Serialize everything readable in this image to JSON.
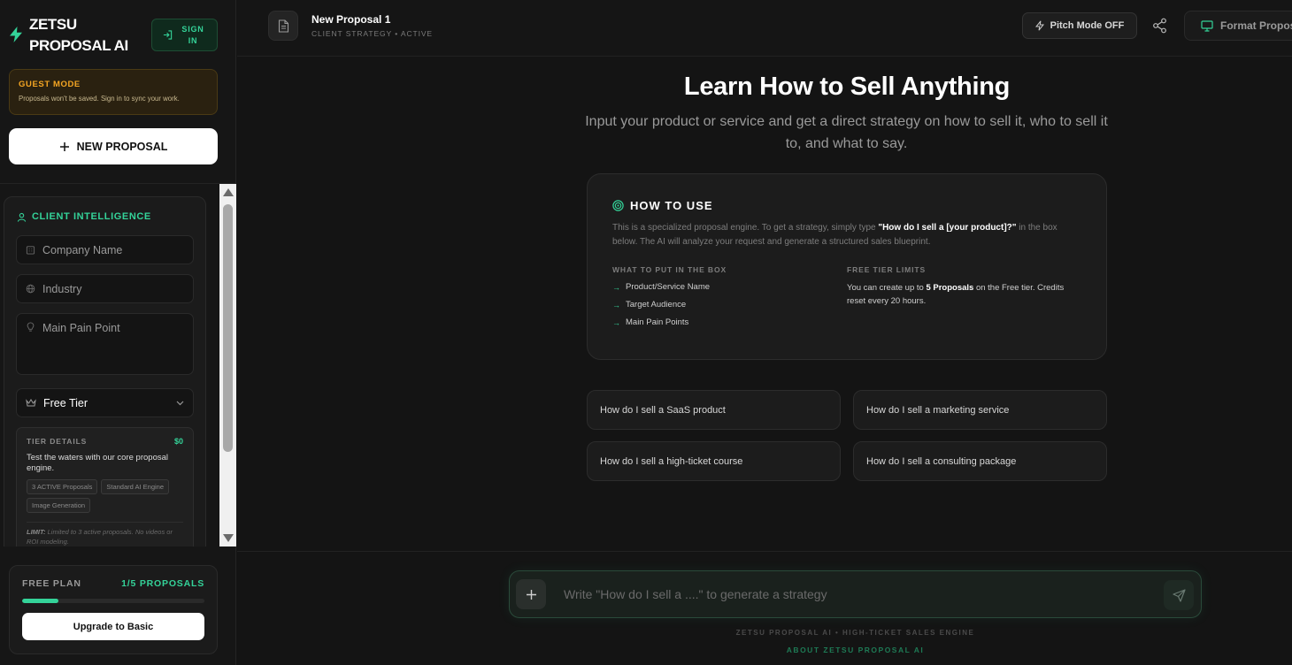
{
  "sidebar": {
    "brand": "ZETSU PROPOSAL AI",
    "sign_in_label": "SIGN IN",
    "guest_title": "GUEST MODE",
    "guest_text": "Proposals won't be saved. Sign in to sync your work.",
    "new_proposal_label": "NEW PROPOSAL",
    "client_intelligence": {
      "title": "CLIENT INTELLIGENCE",
      "company_placeholder": "Company Name",
      "industry_placeholder": "Industry",
      "pain_point_placeholder": "Main Pain Point",
      "tier_selected": "Free Tier",
      "tier_details": {
        "title": "TIER DETAILS",
        "price": "$0",
        "description": "Test the waters with our core proposal engine.",
        "features": [
          "3 ACTIVE Proposals",
          "Standard AI Engine",
          "Image Generation"
        ],
        "limit_label": "LIMIT:",
        "limit_text": "Limited to 3 active proposals. No videos or ROI modeling."
      }
    },
    "plan": {
      "name": "FREE PLAN",
      "count": "1/5 PROPOSALS",
      "progress": 0.2,
      "upgrade_label": "Upgrade to Basic"
    }
  },
  "header": {
    "doc_title": "New Proposal 1",
    "doc_subtitle": "CLIENT STRATEGY • ACTIVE",
    "pitch_mode_label": "Pitch Mode OFF",
    "format_label": "Format Proposal"
  },
  "main": {
    "title": "Learn How to Sell Anything",
    "subtitle": "Input your product or service and get a direct strategy on how to sell it, who to sell it to, and what to say.",
    "how_to_use": {
      "title": "HOW TO USE",
      "text_before": "This is a specialized proposal engine. To get a strategy, simply type ",
      "text_bold": "\"How do I sell a [your product]?\"",
      "text_after": " in the box below. The AI will analyze your request and generate a structured sales blueprint.",
      "col1_title": "WHAT TO PUT IN THE BOX",
      "col1_items": [
        "Product/Service Name",
        "Target Audience",
        "Main Pain Points"
      ],
      "col2_title": "FREE TIER LIMITS",
      "col2_before": "You can create up to ",
      "col2_bold": "5 Proposals",
      "col2_after": " on the Free tier. Credits reset every 20 hours."
    },
    "suggestions": [
      "How do I sell a SaaS product",
      "How do I sell a marketing service",
      "How do I sell a high-ticket course",
      "How do I sell a consulting package"
    ]
  },
  "composer": {
    "placeholder": "Write \"How do I sell a ....\" to generate a strategy",
    "footer_note": "ZETSU PROPOSAL AI • HIGH-TICKET SALES ENGINE",
    "footer_link": "ABOUT ZETSU PROPOSAL AI"
  },
  "colors": {
    "accent": "#34d399",
    "background": "#141414",
    "guest_warning": "#f5a623"
  }
}
